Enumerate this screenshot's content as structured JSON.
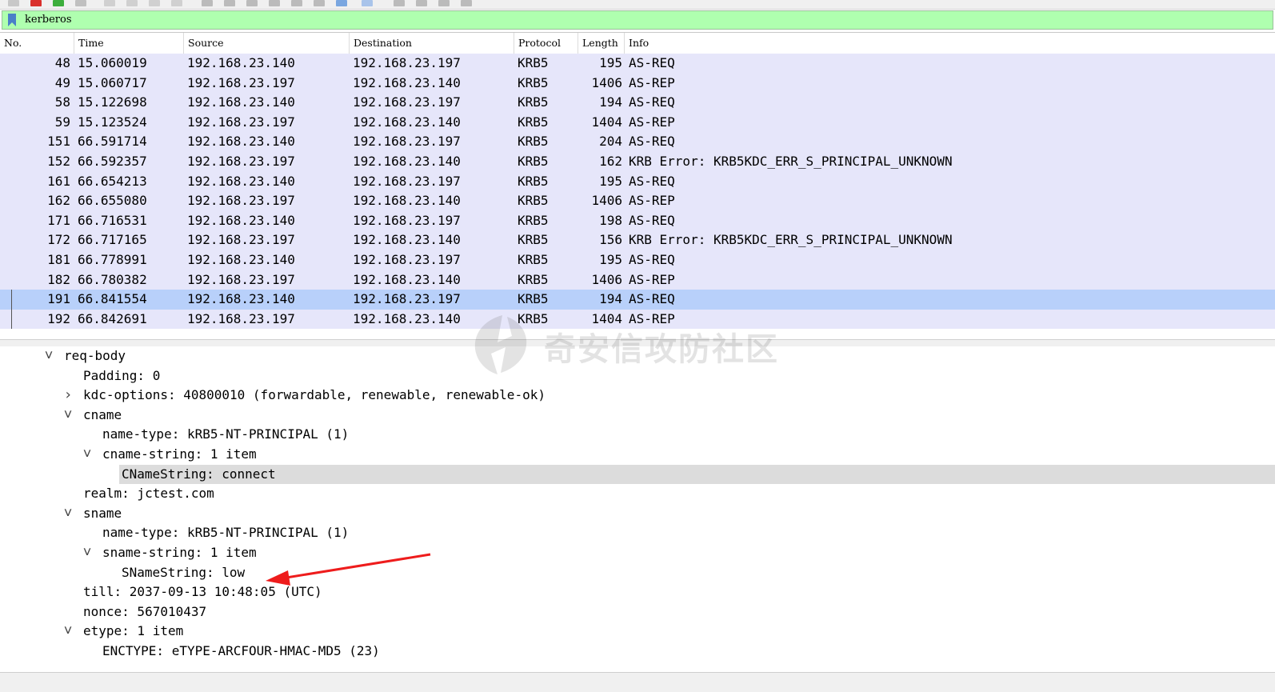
{
  "filter": {
    "value": "kerberos",
    "bookmark_icon": "bookmark-icon"
  },
  "packet_list": {
    "columns": [
      "No.",
      "Time",
      "Source",
      "Destination",
      "Protocol",
      "Length",
      "Info"
    ],
    "rows": [
      {
        "no": "48",
        "time": "15.060019",
        "src": "192.168.23.140",
        "dst": "192.168.23.197",
        "proto": "KRB5",
        "len": "195",
        "info": "AS-REQ"
      },
      {
        "no": "49",
        "time": "15.060717",
        "src": "192.168.23.197",
        "dst": "192.168.23.140",
        "proto": "KRB5",
        "len": "1406",
        "info": "AS-REP"
      },
      {
        "no": "58",
        "time": "15.122698",
        "src": "192.168.23.140",
        "dst": "192.168.23.197",
        "proto": "KRB5",
        "len": "194",
        "info": "AS-REQ"
      },
      {
        "no": "59",
        "time": "15.123524",
        "src": "192.168.23.197",
        "dst": "192.168.23.140",
        "proto": "KRB5",
        "len": "1404",
        "info": "AS-REP"
      },
      {
        "no": "151",
        "time": "66.591714",
        "src": "192.168.23.140",
        "dst": "192.168.23.197",
        "proto": "KRB5",
        "len": "204",
        "info": "AS-REQ"
      },
      {
        "no": "152",
        "time": "66.592357",
        "src": "192.168.23.197",
        "dst": "192.168.23.140",
        "proto": "KRB5",
        "len": "162",
        "info": "KRB Error: KRB5KDC_ERR_S_PRINCIPAL_UNKNOWN"
      },
      {
        "no": "161",
        "time": "66.654213",
        "src": "192.168.23.140",
        "dst": "192.168.23.197",
        "proto": "KRB5",
        "len": "195",
        "info": "AS-REQ"
      },
      {
        "no": "162",
        "time": "66.655080",
        "src": "192.168.23.197",
        "dst": "192.168.23.140",
        "proto": "KRB5",
        "len": "1406",
        "info": "AS-REP"
      },
      {
        "no": "171",
        "time": "66.716531",
        "src": "192.168.23.140",
        "dst": "192.168.23.197",
        "proto": "KRB5",
        "len": "198",
        "info": "AS-REQ"
      },
      {
        "no": "172",
        "time": "66.717165",
        "src": "192.168.23.197",
        "dst": "192.168.23.140",
        "proto": "KRB5",
        "len": "156",
        "info": "KRB Error: KRB5KDC_ERR_S_PRINCIPAL_UNKNOWN"
      },
      {
        "no": "181",
        "time": "66.778991",
        "src": "192.168.23.140",
        "dst": "192.168.23.197",
        "proto": "KRB5",
        "len": "195",
        "info": "AS-REQ"
      },
      {
        "no": "182",
        "time": "66.780382",
        "src": "192.168.23.197",
        "dst": "192.168.23.140",
        "proto": "KRB5",
        "len": "1406",
        "info": "AS-REP"
      },
      {
        "no": "191",
        "time": "66.841554",
        "src": "192.168.23.140",
        "dst": "192.168.23.197",
        "proto": "KRB5",
        "len": "194",
        "info": "AS-REQ"
      },
      {
        "no": "192",
        "time": "66.842691",
        "src": "192.168.23.197",
        "dst": "192.168.23.140",
        "proto": "KRB5",
        "len": "1404",
        "info": "AS-REP"
      }
    ],
    "selected_index": 12,
    "row_color": "#e6e6fa",
    "selected_color": "#b8d0fa"
  },
  "details": {
    "lines": [
      {
        "text": "req-body",
        "toggle": "expanded"
      },
      {
        "text": "Padding: 0",
        "toggle": "none"
      },
      {
        "text": "kdc-options: 40800010 (forwardable, renewable, renewable-ok)",
        "toggle": "collapsed"
      },
      {
        "text": "cname",
        "toggle": "expanded"
      },
      {
        "text": "name-type: kRB5-NT-PRINCIPAL (1)",
        "toggle": "none"
      },
      {
        "text": "cname-string: 1 item",
        "toggle": "expanded"
      },
      {
        "text": "CNameString: connect",
        "toggle": "none",
        "highlighted": true
      },
      {
        "text": "realm: jctest.com",
        "toggle": "none"
      },
      {
        "text": "sname",
        "toggle": "expanded"
      },
      {
        "text": "name-type: kRB5-NT-PRINCIPAL (1)",
        "toggle": "none"
      },
      {
        "text": "sname-string: 1 item",
        "toggle": "expanded"
      },
      {
        "text": "SNameString: low",
        "toggle": "none"
      },
      {
        "text": "till: 2037-09-13 10:48:05 (UTC)",
        "toggle": "none"
      },
      {
        "text": "nonce: 567010437",
        "toggle": "none"
      },
      {
        "text": "etype: 1 item",
        "toggle": "expanded"
      },
      {
        "text": "ENCTYPE: eTYPE-ARCFOUR-HMAC-MD5 (23)",
        "toggle": "none"
      }
    ]
  },
  "watermark": {
    "text": "奇安信攻防社区",
    "logo_icon": "lightning-logo-icon"
  },
  "annotation": {
    "arrow_color": "#ee1c1c",
    "icon": "red-arrow-icon"
  }
}
